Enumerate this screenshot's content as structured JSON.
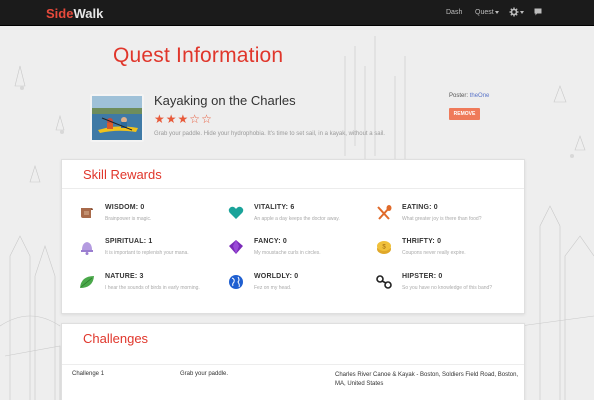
{
  "navbar": {
    "brand_part1": "Side",
    "brand_part2": "Walk",
    "dash": "Dash",
    "quest": "Quest"
  },
  "page_title": "Quest Information",
  "quest": {
    "name": "Kayaking on the Charles",
    "rating": 3,
    "rating_max": 5,
    "description": "Grab your paddle. Hide your hydrophobia. It's time to set sail, in a kayak, without a sail.",
    "poster_label": "Poster:",
    "poster_name": "theOne",
    "remove_label": "REMOVE"
  },
  "skill_rewards": {
    "title": "Skill Rewards",
    "skills": [
      {
        "name": "WISDOM: 0",
        "desc": "Brainpower is magic.",
        "icon": "scroll-icon"
      },
      {
        "name": "VITALITY: 6",
        "desc": "An apple a day keeps the doctor away.",
        "icon": "heart-icon"
      },
      {
        "name": "EATING: 0",
        "desc": "What greater joy is there than food?",
        "icon": "fork-spoon-icon"
      },
      {
        "name": "SPIRITUAL: 1",
        "desc": "It is important to replenish your mana.",
        "icon": "bell-icon"
      },
      {
        "name": "FANCY: 0",
        "desc": "My moustache curls in circles.",
        "icon": "gem-icon"
      },
      {
        "name": "THRIFTY: 0",
        "desc": "Coupons never really expire.",
        "icon": "coins-icon"
      },
      {
        "name": "NATURE: 3",
        "desc": "I hear the sounds of birds in early morning.",
        "icon": "leaf-icon"
      },
      {
        "name": "WORLDLY: 0",
        "desc": "Fez on my head.",
        "icon": "globe-icon"
      },
      {
        "name": "HIPSTER: 0",
        "desc": "So you have no knowledge of this band?",
        "icon": "glasses-icon"
      }
    ]
  },
  "challenges": {
    "title": "Challenges",
    "rows": [
      {
        "label": "Challenge 1",
        "task": "Grab your paddle.",
        "location": "Charles River Canoe & Kayak - Boston, Soldiers Field Road, Boston, MA, United States"
      }
    ]
  },
  "colors": {
    "accent": "#e0362b",
    "navbar_bg": "#1b1b1b",
    "remove_button": "#ef7a5a",
    "poster_link": "#5a74c8"
  }
}
